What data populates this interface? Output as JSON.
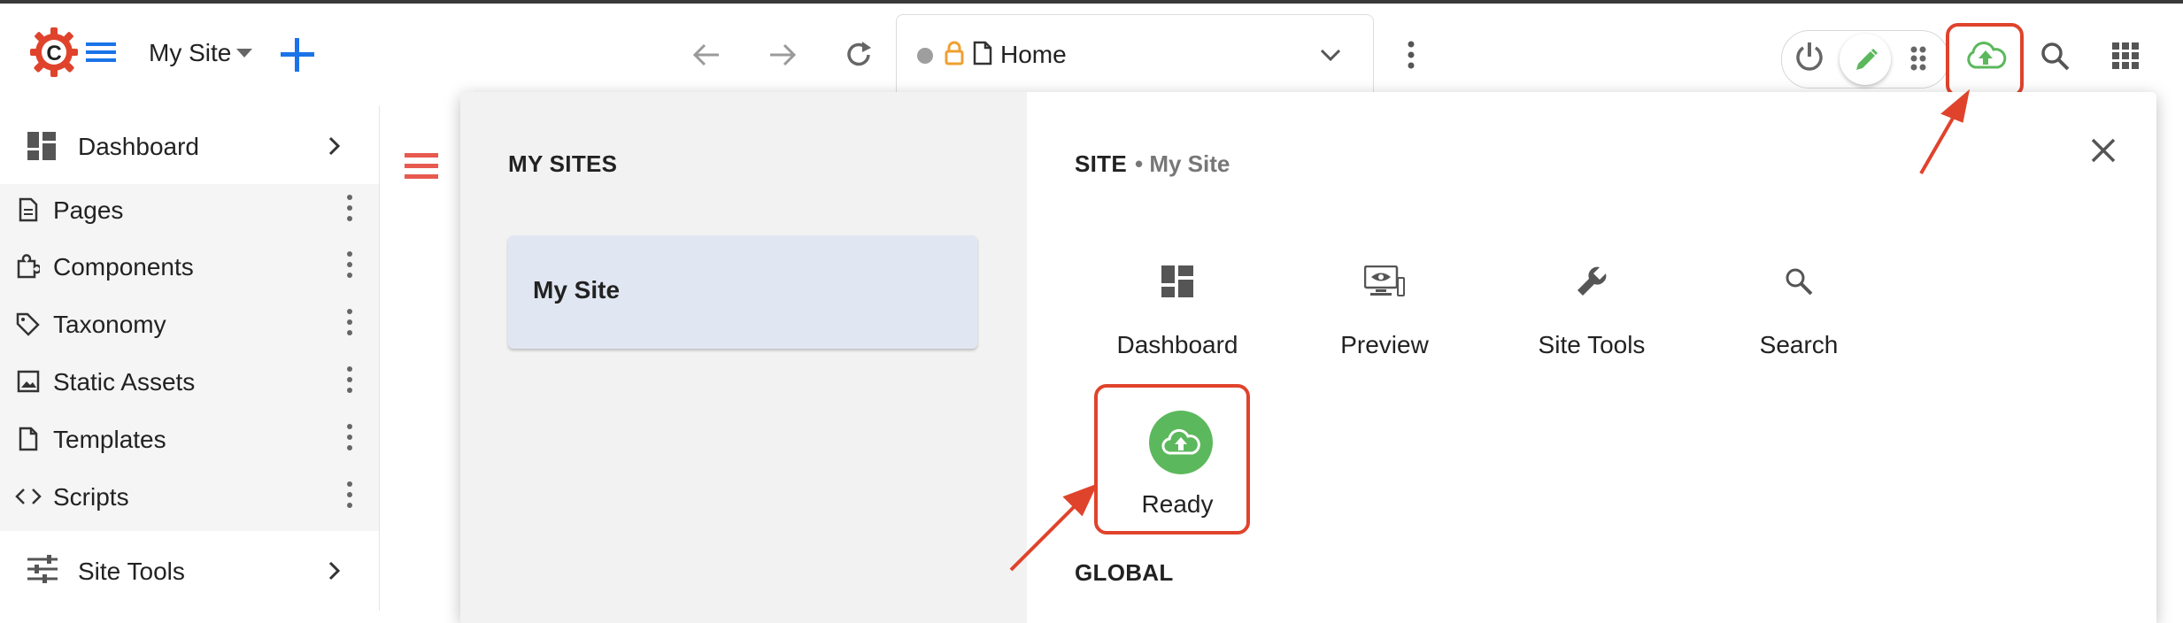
{
  "header": {
    "site_selector": "My Site",
    "address": {
      "url_label": "Home"
    }
  },
  "sidebar": {
    "dashboard": "Dashboard",
    "items": [
      {
        "label": "Pages",
        "icon": "page-icon"
      },
      {
        "label": "Components",
        "icon": "puzzle-icon"
      },
      {
        "label": "Taxonomy",
        "icon": "tag-icon"
      },
      {
        "label": "Static Assets",
        "icon": "image-icon"
      },
      {
        "label": "Templates",
        "icon": "file-icon"
      },
      {
        "label": "Scripts",
        "icon": "code-icon"
      }
    ],
    "site_tools": "Site Tools"
  },
  "launcher": {
    "my_sites_title": "MY SITES",
    "site_card": "My Site",
    "site_title": "SITE",
    "site_subtitle": "• My Site",
    "tiles": [
      "Dashboard",
      "Preview",
      "Site Tools",
      "Search"
    ],
    "ready_label": "Ready",
    "global_title": "GLOBAL"
  },
  "colors": {
    "accent_blue": "#1a73e8",
    "publish_green": "#5cb85c",
    "highlight_red": "#e0432c",
    "menu_red": "#e85a4f",
    "lock_orange": "#f0a030"
  }
}
